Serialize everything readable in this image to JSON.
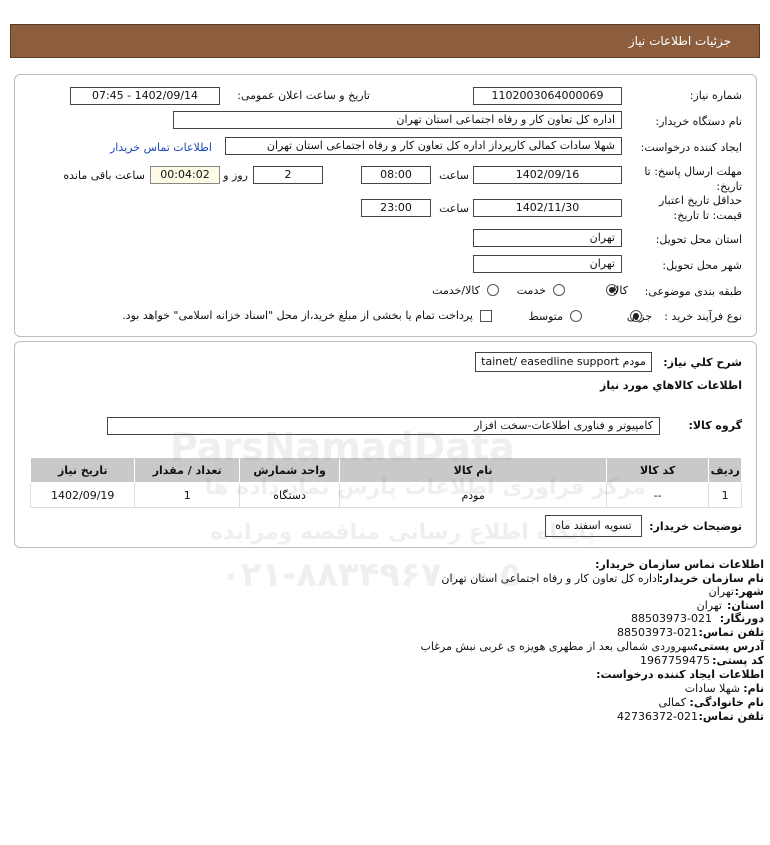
{
  "header": {
    "title": "جزئیات اطلاعات نیاز"
  },
  "form": {
    "need_number_label": "شماره نیاز:",
    "need_number": "1102003064000069",
    "announce_label": "تاریخ و ساعت اعلان عمومی:",
    "announce_value": "1402/09/14 - 07:45",
    "buyer_label": "نام دستگاه خریدار:",
    "buyer_value": "اداره کل تعاون  کار و رفاه اجتماعی استان تهران",
    "creator_label": "ایجاد کننده درخواست:",
    "creator_value": "شهلا سادات کمالی کارپرداز اداره کل تعاون  کار و رفاه اجتماعی استان تهران",
    "contact_link": "اطلاعات تماس خریدار",
    "deadline_label_1": "مهلت ارسال پاسخ: تا",
    "deadline_label_2": "تاریخ:",
    "deadline_date": "1402/09/16",
    "time_label": "ساعت",
    "deadline_time": "08:00",
    "days_value": "2",
    "days_label": "روز و",
    "timer_value": "00:04:02",
    "remaining_label": "ساعت باقی مانده",
    "validity_label_1": "حداقل تاریخ اعتبار",
    "validity_label_2": "قیمت: تا تاریخ:",
    "validity_date": "1402/11/30",
    "validity_time": "23:00",
    "province_label": "استان محل تحویل:",
    "province_value": "تهران",
    "city_label": "شهر محل تحویل:",
    "city_value": "تهران",
    "category_label": "طبقه بندی موضوعی:",
    "category_options": [
      "کالا",
      "خدمت",
      "کالا/خدمت"
    ],
    "process_label": "نوع فرآیند خرید :",
    "process_options": [
      "جزیی",
      "متوسط"
    ],
    "payment_text": "پرداخت تمام یا بخشی از مبلغ خرید،از محل \"اسناد خزانه اسلامی\" خواهد بود."
  },
  "goods": {
    "summary_label": "شرح کلي نياز:",
    "summary_value": "مودم tainet/ easedline support",
    "info_title": "اطلاعات کالاهاي مورد نياز",
    "group_label": "گروه کالا:",
    "group_value": "کامپیوتر و فناوری اطلاعات-سخت افزار",
    "columns": [
      "رديف",
      "کد کالا",
      "نام کالا",
      "واحد شمارش",
      "تعداد / مقدار",
      "تاریخ نیاز"
    ],
    "rows": [
      [
        "1",
        "--",
        "مودم",
        "دستگاه",
        "1",
        "1402/09/19"
      ]
    ],
    "buyer_notes_label": "توضیحات خریدار:",
    "buyer_notes_value": "تسویه اسفند ماه"
  },
  "contact": {
    "title": "اطلاعات تماس سازمان خریدار:",
    "org_label": "نام سازمان خریدار:",
    "org_value": "اداره کل تعاون کار و رفاه اجتماعی استان تهران",
    "city_label": "شهر:",
    "city_value": "تهران",
    "province_label": "استان:",
    "province_value": "تهران",
    "fax_label": "دورنگار:",
    "fax_value": "88503973-021",
    "phone_label": "تلفن تماس:",
    "phone_value": "88503973-021",
    "address_label": "آدرس پستی:",
    "address_value": "سهروردی شمالی بعد از مطهری هویزه ی غربی نبش مرغاب",
    "postal_label": "کد پستی:",
    "postal_value": "1967759475",
    "creator_title": "اطلاعات ایجاد کننده درخواست:",
    "name_label": "نام:",
    "name_value": "شهلا سادات",
    "family_label": "نام خانوادگی:",
    "family_value": "کمالی",
    "creator_phone_label": "تلفن تماس:",
    "creator_phone_value": "42736372-021"
  },
  "watermark": {
    "brand": "ParsNamadData",
    "line1": "مرکز فراوری اطلاعات پارس نماد داده ها",
    "line2": "پایگاه اطلاع رسانی مناقصه ومزایده",
    "phone": "۰۲۱-۸۸۳۴۹۶۷۰ - ۵"
  }
}
